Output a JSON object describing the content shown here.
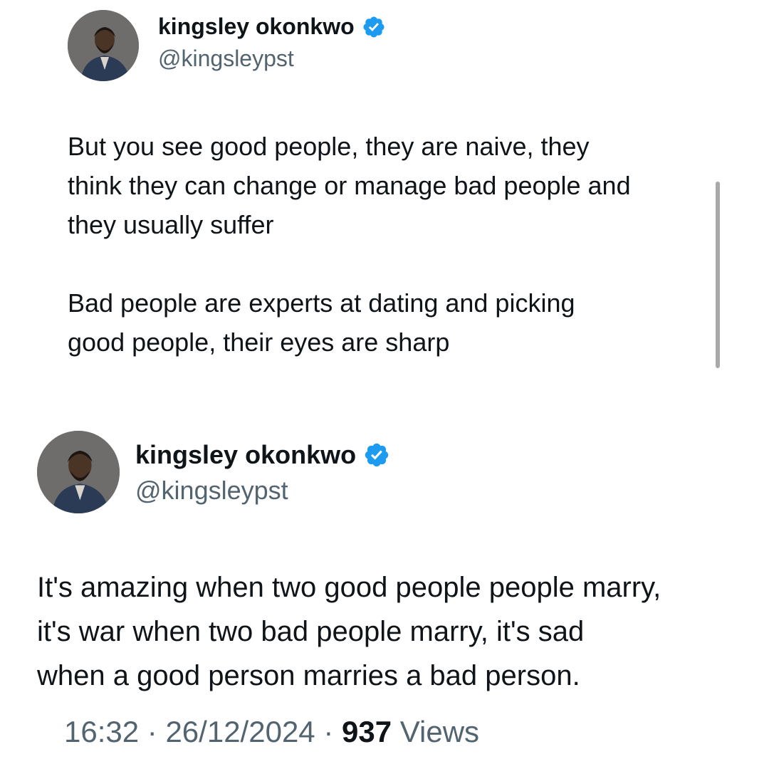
{
  "tweets": [
    {
      "display_name": "kingsley okonkwo",
      "handle": "@kingsleypst",
      "verified_icon": "verified-badge-icon",
      "text_paragraphs": [
        [
          "But you see good people, they are naive, they",
          "think they can change or manage bad people and",
          "they usually suffer"
        ],
        [
          "Bad people are experts at dating and picking",
          "good people, their eyes are sharp"
        ]
      ]
    },
    {
      "display_name": "kingsley okonkwo",
      "handle": "@kingsleypst",
      "verified_icon": "verified-badge-icon",
      "text_paragraphs": [
        [
          "It's amazing when two good people people marry,",
          "it's war when two bad people marry, it's sad",
          "when a good person marries a bad person."
        ]
      ]
    }
  ],
  "meta": {
    "time": "16:32",
    "separator": "·",
    "date": "26/12/2024",
    "views_count": "937",
    "views_label": "Views"
  },
  "colors": {
    "verified_blue": "#1d9bf0",
    "text_primary": "#0f1419",
    "text_secondary": "#536471"
  }
}
